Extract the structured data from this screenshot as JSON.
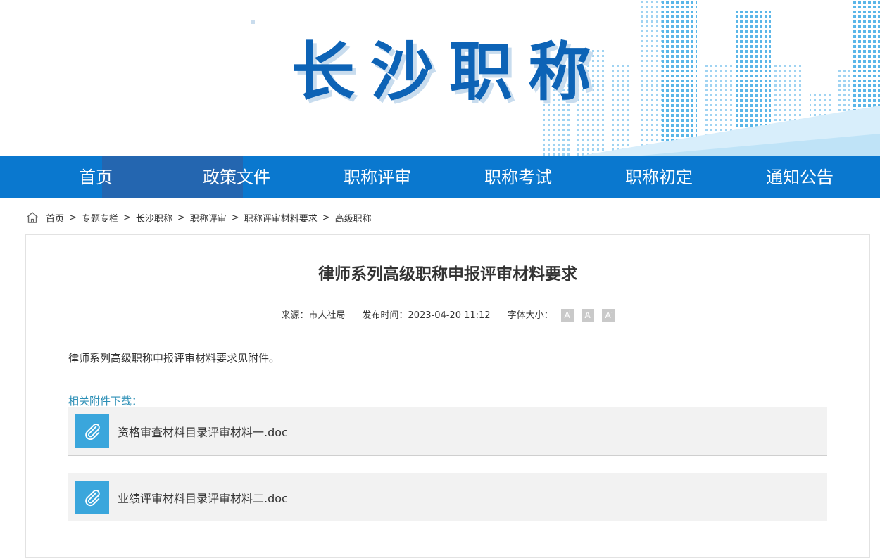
{
  "site": {
    "title": "长沙职称"
  },
  "nav": {
    "items": [
      {
        "label": "首页"
      },
      {
        "label": "政策文件"
      },
      {
        "label": "职称评审"
      },
      {
        "label": "职称考试"
      },
      {
        "label": "职称初定"
      },
      {
        "label": "通知公告"
      }
    ]
  },
  "breadcrumb": {
    "items": [
      "首页",
      "专题专栏",
      "长沙职称",
      "职称评审",
      "职称评审材料要求",
      "高级职称"
    ],
    "separator": ">"
  },
  "article": {
    "title": "律师系列高级职称申报评审材料要求",
    "source_label": "来源：市人社局",
    "date_label": "发布时间：2023-04-20 11:12",
    "font_size_label": "字体大小：",
    "font_buttons": [
      "A",
      "A",
      "A"
    ],
    "body": "律师系列高级职称申报评审材料要求见附件。",
    "attachments_title": "相关附件下载：",
    "attachments": [
      {
        "name": "资格审查材料目录评审材料一.doc"
      },
      {
        "name": "业绩评审材料目录评审材料二.doc"
      }
    ]
  },
  "colors": {
    "nav_bg": "#0a78cf",
    "nav_active": "#2466b0",
    "title_blue": "#0d63b6",
    "attach_link": "#2c8fb6",
    "clip_bg": "#3aa6dc"
  }
}
